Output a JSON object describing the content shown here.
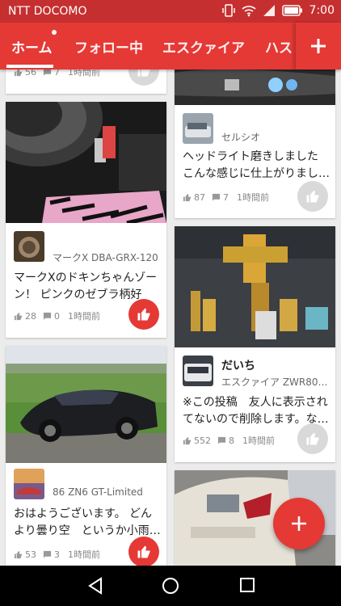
{
  "status_bar": {
    "carrier": "NTT DOCOMO",
    "time": "7:00"
  },
  "tabs": [
    {
      "label": "ホーム",
      "active": true
    },
    {
      "label": "フォロー中",
      "active": false
    },
    {
      "label": "エスクァイア",
      "active": false
    },
    {
      "label": "ハス",
      "active": false
    }
  ],
  "add_tab_icon": "plus-icon",
  "feed": {
    "left_top_partial": {
      "likes": "56",
      "comments": "7",
      "time": "1時間前",
      "liked": false
    },
    "left_card_1": {
      "username": "",
      "car": "マークX DBA-GRX-120",
      "text": "マークXのドキンちゃんゾーン！ ピンクのゼブラ柄好き…",
      "likes": "28",
      "comments": "0",
      "time": "1時間前",
      "liked": true
    },
    "left_card_2": {
      "username": "",
      "car": "86 ZN6 GT-Limited",
      "text": "おはようございます。 どんより曇り空　というか小雨…",
      "likes": "53",
      "comments": "3",
      "time": "1時間前",
      "liked": true
    },
    "right_card_1": {
      "username": "",
      "car": "セルシオ",
      "text": "ヘッドライト磨きしました こんな感じに仕上がりまし…",
      "likes": "87",
      "comments": "7",
      "time": "1時間前",
      "liked": false
    },
    "right_card_2": {
      "username": "だいち",
      "car": "エスクァイア ZWR80G …",
      "text": "※この投稿　友人に表示されてないので削除します。な…",
      "likes": "552",
      "comments": "8",
      "time": "1時間前",
      "liked": false
    }
  },
  "fab_icon": "plus-icon",
  "nav": {
    "back": "back-icon",
    "home": "home-icon",
    "recents": "recents-icon"
  },
  "colors": {
    "primary": "#e53935",
    "status_bar": "#c62f2f",
    "background": "#ececec"
  }
}
